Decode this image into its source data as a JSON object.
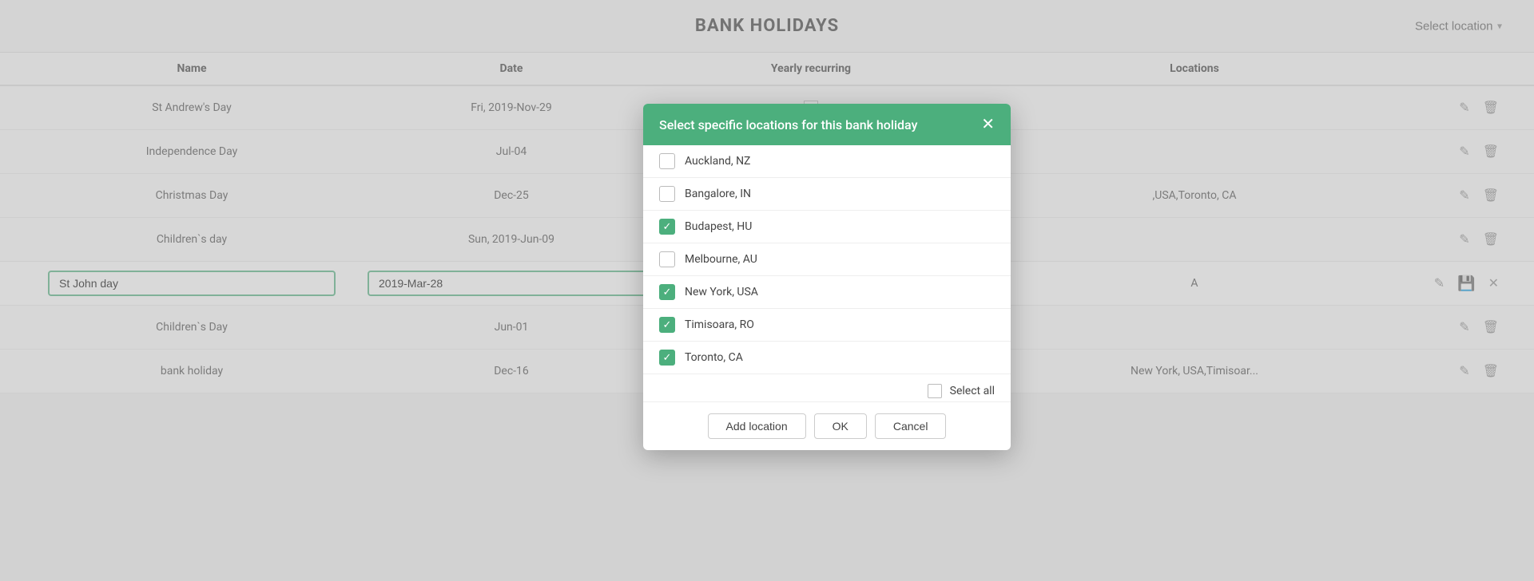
{
  "page": {
    "title": "BANK HOLIDAYS",
    "location_select_placeholder": "Select location",
    "location_select_arrow": "▾"
  },
  "table": {
    "headers": [
      "Name",
      "Date",
      "Yearly recurring",
      "Locations",
      ""
    ],
    "rows": [
      {
        "name": "St Andrew's Day",
        "date": "Fri, 2019-Nov-29",
        "yearly_recurring": "checkbox_unchecked",
        "locations": "",
        "editing": false
      },
      {
        "name": "Independence Day",
        "date": "Jul-04",
        "yearly_recurring": "checkbox_checked_gray",
        "locations": "",
        "editing": false
      },
      {
        "name": "Christmas Day",
        "date": "Dec-25",
        "yearly_recurring": "checkbox_checked_gray",
        "locations": "USA,Toronto, CA",
        "locations_display": ",USA,Toronto, CA",
        "editing": false
      },
      {
        "name": "Children`s day",
        "date": "Sun, 2019-Jun-09",
        "yearly_recurring": "checkbox_unchecked_gray",
        "locations": "",
        "editing": false
      },
      {
        "name": "St John day",
        "date": "2019-Mar-28",
        "yearly_recurring": "checkbox_checked_green",
        "locations": "A",
        "editing": true
      },
      {
        "name": "Children`s Day",
        "date": "Jun-01",
        "yearly_recurring": "checkbox_checked_gray",
        "locations": "",
        "editing": false
      },
      {
        "name": "bank holiday",
        "date": "Dec-16",
        "yearly_recurring": "checkbox_checked_gray",
        "locations": "New York, USA,Timisoar...",
        "editing": false
      }
    ]
  },
  "modal": {
    "title": "Select specific locations for this bank holiday",
    "close_icon": "✕",
    "locations": [
      {
        "name": "Auckland, NZ",
        "checked": false
      },
      {
        "name": "Bangalore, IN",
        "checked": false
      },
      {
        "name": "Budapest, HU",
        "checked": true
      },
      {
        "name": "Melbourne, AU",
        "checked": false
      },
      {
        "name": "New York, USA",
        "checked": true
      },
      {
        "name": "Timisoara, RO",
        "checked": true
      },
      {
        "name": "Toronto, CA",
        "checked": true
      }
    ],
    "select_all_label": "Select all",
    "buttons": {
      "add_location": "Add location",
      "ok": "OK",
      "cancel": "Cancel"
    }
  }
}
